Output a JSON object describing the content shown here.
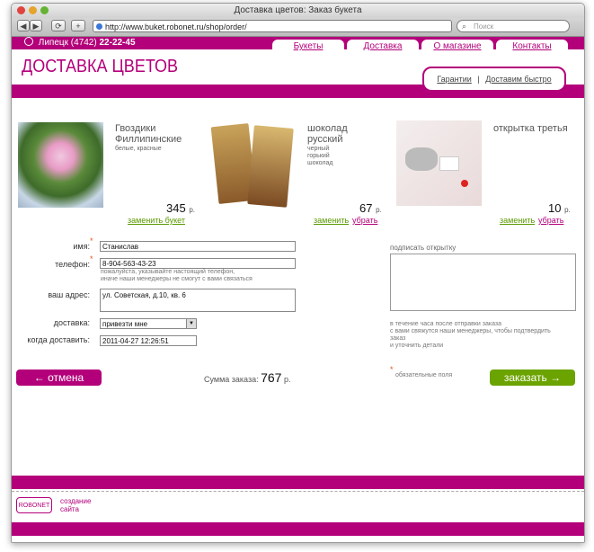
{
  "window": {
    "title": "Доставка цветов:  Заказ букета"
  },
  "browser": {
    "back": "◀",
    "forward": "▶",
    "reload": "⟳",
    "add": "+",
    "url": "http://www.buket.robonet.ru/shop/order/",
    "search_placeholder": "Поиск"
  },
  "header": {
    "city": "Липецк",
    "phone_code": "(4742)",
    "phone": "22-22-45",
    "logo": "ДОСТАВКА ЦВЕТОВ",
    "nav": [
      "Букеты",
      "Доставка",
      "О магазине",
      "Контакты"
    ],
    "subnav": [
      "Гарантии",
      "Доставим быстро"
    ],
    "subnav_sep": "|"
  },
  "products": [
    {
      "name_line1": "Гвоздики",
      "name_line2": "Филлипинские",
      "sub": "белые, красные",
      "price": "345",
      "unit": "р.",
      "replace": "заменить букет",
      "remove": ""
    },
    {
      "name_line1": "шоколад",
      "name_line2": "русский",
      "sub": "черный горький шоколад",
      "price": "67",
      "unit": "р.",
      "replace": "заменить",
      "remove": "убрать"
    },
    {
      "name_line1": "открытка третья",
      "name_line2": "",
      "sub": "",
      "price": "10",
      "unit": "р.",
      "replace": "заменить",
      "remove": "убрать"
    }
  ],
  "form": {
    "name_label": "имя:",
    "name_value": "Станислав",
    "phone_label": "телефон:",
    "phone_value": "8-904-563-43-23",
    "phone_hint1": "пожалуйста, указывайте настоящий телефон,",
    "phone_hint2": "иначе наши менеджеры не смогут с вами связаться",
    "address_label": "ваш адрес:",
    "address_value": "ул. Советская, д.10, кв. 6",
    "delivery_label": "доставка:",
    "delivery_value": "привезти мне",
    "when_label": "когда доставить:",
    "when_value": "2011-04-27 12:26:51",
    "card_label": "подписать открытку",
    "card_hint": [
      "в течение часа после отправки заказа",
      "с вами свяжутся наши менеджеры, чтобы подтвердить",
      "заказ",
      "и уточнить детали"
    ],
    "required_star": "*",
    "required_note": "обязательные поля"
  },
  "actions": {
    "cancel": "← отмена",
    "order": "заказать →",
    "sum_label": "Сумма заказа:",
    "sum_value": "767",
    "sum_unit": "р."
  },
  "footer": {
    "robonet": "ROBONET",
    "line1": "создание",
    "line2": "сайта"
  },
  "colors": {
    "brand": "#b3007a",
    "green": "#6ba300"
  }
}
